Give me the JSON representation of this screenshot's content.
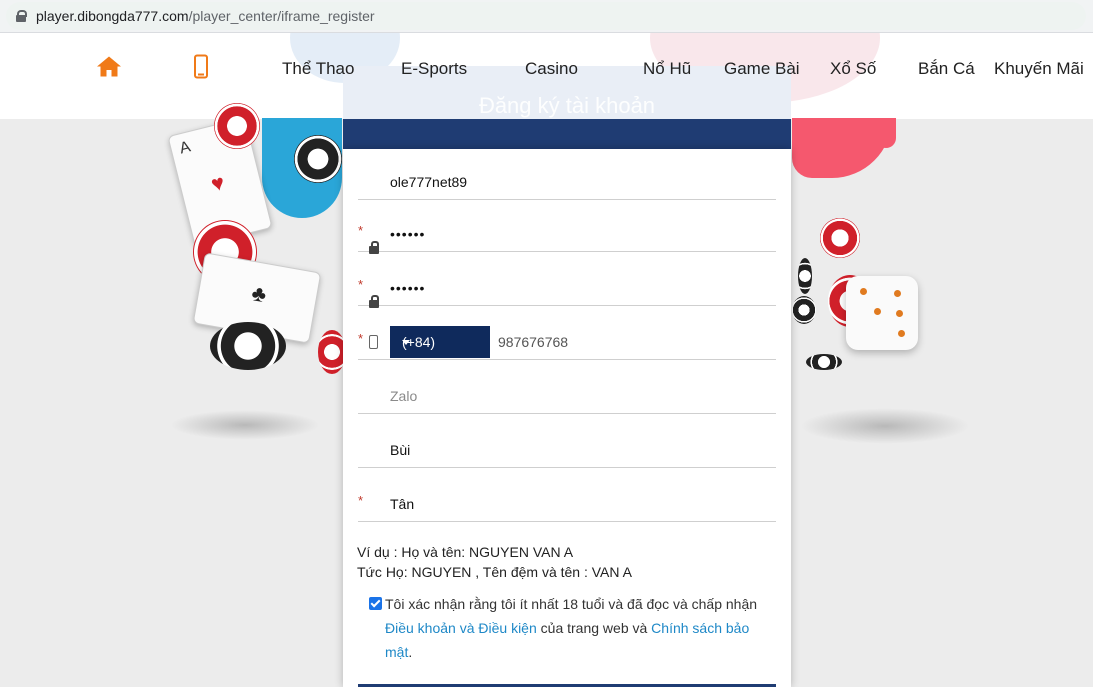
{
  "browser": {
    "url_host": "player.dibongda777.com",
    "url_path": "/player_center/iframe_register"
  },
  "nav": {
    "items": [
      "Thể Thao",
      "E-Sports",
      "Casino",
      "Nổ Hũ",
      "Game Bài",
      "Xổ Số",
      "Bắn Cá",
      "Khuyến Mãi"
    ],
    "icons": [
      "home-icon",
      "mobile-phone-icon"
    ],
    "accent_color": "#f07a18"
  },
  "form": {
    "title": "Đăng ký tài khoản",
    "username_value": "ole777net89",
    "password_value": "••••••",
    "confirm_password_value": "••••••",
    "required_mark": "*",
    "country_code": "(+84)",
    "phone_value": "987676768",
    "zalo_placeholder": "Zalo",
    "last_name_value": "Bùi",
    "first_name_value": "Tân",
    "hint_line1": "Ví dụ : Họ và tên: NGUYEN VAN A",
    "hint_line2": "Tức Họ: NGUYEN , Tên đệm và tên : VAN A",
    "agree_checked": true,
    "agree_text1": "Tôi xác nhận rằng tôi ít nhất 18 tuổi và đã đọc và chấp nhận ",
    "agree_link1": "Điều khoản và Điều kiện",
    "agree_text2": " của trang web và ",
    "agree_link2": "Chính sách bảo mật",
    "agree_text3": ".",
    "header_color": "#1f3c73",
    "country_code_bg": "#0f2a5c"
  }
}
